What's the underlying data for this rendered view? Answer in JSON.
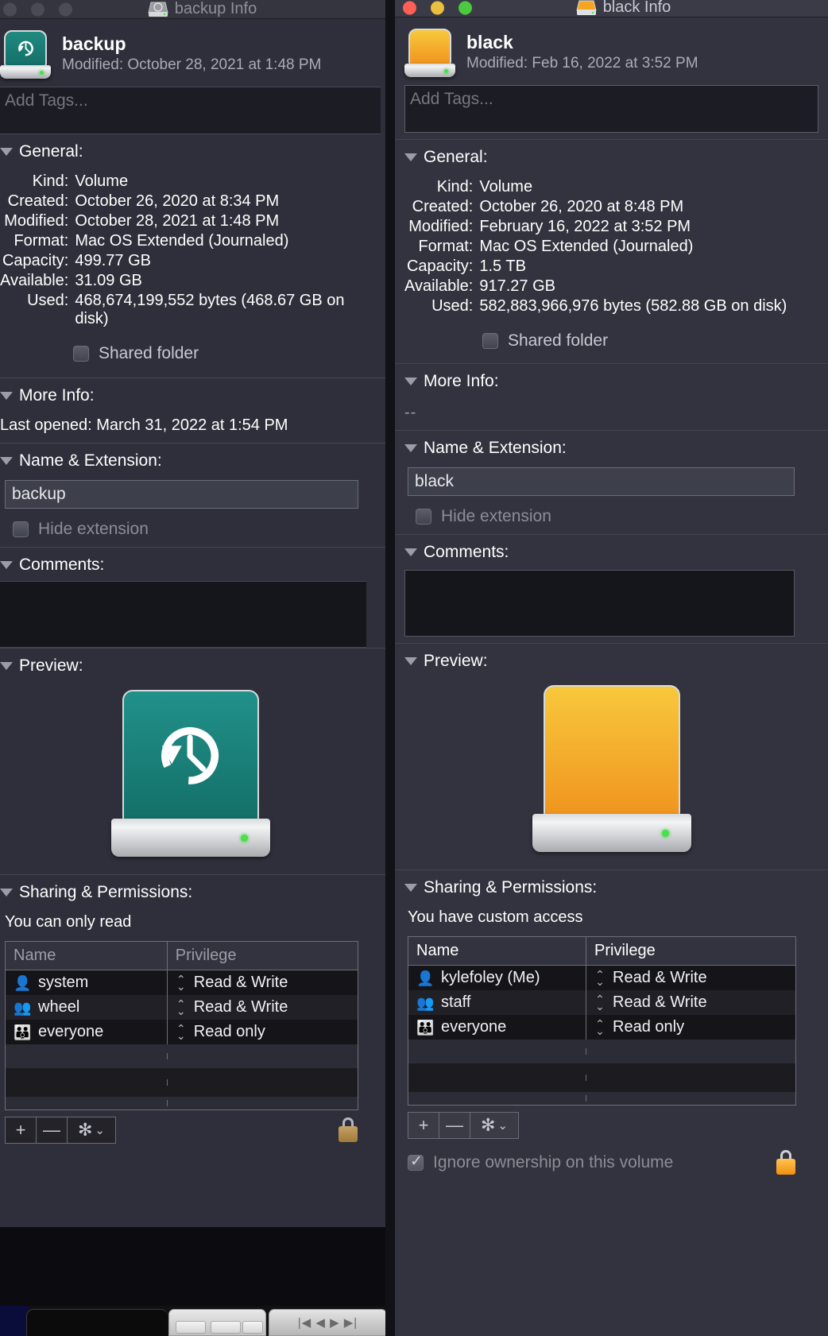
{
  "background_app": {
    "name": "media-player-toolbar",
    "transport_glyphs": "|◀  ◀  ▶  ▶|"
  },
  "windows": [
    {
      "id": "backup",
      "state": "inactive",
      "title": "backup Info",
      "title_icon": "hard-drive-icon",
      "traffic_lights": [
        "close",
        "minimize",
        "zoom"
      ],
      "header": {
        "name": "backup",
        "modified_label": "Modified:",
        "modified_value": "October 28, 2021 at 1:48 PM",
        "icon": "time-machine-drive-icon"
      },
      "tags": {
        "placeholder": "Add Tags...",
        "value": ""
      },
      "general": {
        "title": "General:",
        "rows": [
          {
            "label": "Kind:",
            "value": "Volume"
          },
          {
            "label": "Created:",
            "value": "October 26, 2020 at 8:34 PM"
          },
          {
            "label": "Modified:",
            "value": "October 28, 2021 at 1:48 PM"
          },
          {
            "label": "Format:",
            "value": "Mac OS Extended (Journaled)"
          },
          {
            "label": "Capacity:",
            "value": "499.77 GB"
          },
          {
            "label": "Available:",
            "value": "31.09 GB"
          },
          {
            "label": "Used:",
            "value": "468,674,199,552 bytes (468.67 GB on disk)"
          }
        ],
        "shared_folder": {
          "label": "Shared folder",
          "checked": false
        }
      },
      "more_info": {
        "title": "More Info:",
        "lines": [
          "Last opened: March 31, 2022 at 1:54 PM"
        ]
      },
      "name_extension": {
        "title": "Name & Extension:",
        "value": "backup",
        "hide_extension": {
          "label": "Hide extension",
          "checked": false,
          "disabled": true
        }
      },
      "comments": {
        "title": "Comments:",
        "value": ""
      },
      "preview": {
        "title": "Preview:",
        "icon": "time-machine-drive-icon",
        "color": "#1a7b72"
      },
      "sharing": {
        "title": "Sharing & Permissions:",
        "access_summary": "You can only read",
        "columns": [
          "Name",
          "Privilege"
        ],
        "rows": [
          {
            "icon": "single-user-icon",
            "name": "system",
            "privilege": "Read & Write"
          },
          {
            "icon": "two-users-icon",
            "name": "wheel",
            "privilege": "Read & Write"
          },
          {
            "icon": "three-users-icon",
            "name": "everyone",
            "privilege": "Read only"
          }
        ],
        "buttons": {
          "add": "+",
          "remove": "—",
          "action": "✻",
          "action_chevron": "⌄"
        },
        "lock": {
          "name": "locked-padlock-icon",
          "state": "locked",
          "color": "#b08a45"
        }
      }
    },
    {
      "id": "black",
      "state": "active",
      "title": "black Info",
      "title_icon": "hard-drive-icon",
      "traffic_lights": [
        "close",
        "minimize",
        "zoom"
      ],
      "header": {
        "name": "black",
        "modified_label": "Modified:",
        "modified_value": "Feb 16, 2022 at 3:52 PM",
        "icon": "orange-drive-icon"
      },
      "tags": {
        "placeholder": "Add Tags...",
        "value": ""
      },
      "general": {
        "title": "General:",
        "rows": [
          {
            "label": "Kind:",
            "value": "Volume"
          },
          {
            "label": "Created:",
            "value": "October 26, 2020 at 8:48 PM"
          },
          {
            "label": "Modified:",
            "value": "February 16, 2022 at 3:52 PM"
          },
          {
            "label": "Format:",
            "value": "Mac OS Extended (Journaled)"
          },
          {
            "label": "Capacity:",
            "value": "1.5 TB"
          },
          {
            "label": "Available:",
            "value": "917.27 GB"
          },
          {
            "label": "Used:",
            "value": "582,883,966,976 bytes (582.88 GB on disk)"
          }
        ],
        "shared_folder": {
          "label": "Shared folder",
          "checked": false
        }
      },
      "more_info": {
        "title": "More Info:",
        "lines": [
          "--"
        ]
      },
      "name_extension": {
        "title": "Name & Extension:",
        "value": "black",
        "hide_extension": {
          "label": "Hide extension",
          "checked": false,
          "disabled": true
        }
      },
      "comments": {
        "title": "Comments:",
        "value": ""
      },
      "preview": {
        "title": "Preview:",
        "icon": "orange-drive-icon",
        "color": "#f5a623"
      },
      "sharing": {
        "title": "Sharing & Permissions:",
        "access_summary": "You have custom access",
        "columns": [
          "Name",
          "Privilege"
        ],
        "rows": [
          {
            "icon": "single-user-icon",
            "name": "kylefoley (Me)",
            "privilege": "Read & Write"
          },
          {
            "icon": "two-users-icon",
            "name": "staff",
            "privilege": "Read & Write"
          },
          {
            "icon": "three-users-icon",
            "name": "everyone",
            "privilege": "Read only"
          }
        ],
        "buttons": {
          "add": "+",
          "remove": "—",
          "action": "✻",
          "action_chevron": "⌄"
        },
        "ignore_ownership": {
          "label": "Ignore ownership on this volume",
          "checked": true,
          "disabled": true
        },
        "lock": {
          "name": "locked-padlock-icon",
          "state": "locked",
          "color": "#f5a623"
        }
      }
    }
  ]
}
